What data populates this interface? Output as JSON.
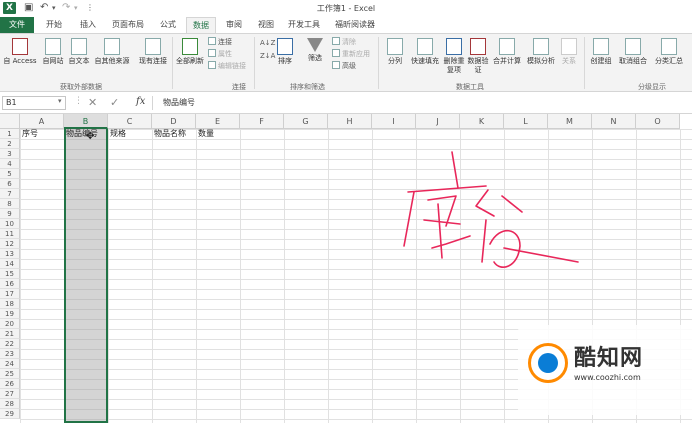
{
  "title_bar": {
    "app_logo": "X",
    "window_title": "工作簿1 - Excel",
    "qat": [
      "save-icon",
      "undo-icon",
      "redo-icon",
      "customize-icon"
    ]
  },
  "tabs": [
    {
      "label": "文件",
      "active": false
    },
    {
      "label": "开始",
      "active": false
    },
    {
      "label": "插入",
      "active": false
    },
    {
      "label": "页面布局",
      "active": false
    },
    {
      "label": "公式",
      "active": false
    },
    {
      "label": "数据",
      "active": true
    },
    {
      "label": "审阅",
      "active": false
    },
    {
      "label": "视图",
      "active": false
    },
    {
      "label": "开发工具",
      "active": false
    },
    {
      "label": "福昕阅读器",
      "active": false
    }
  ],
  "ribbon": {
    "get_external": {
      "buttons": [
        "自 Access",
        "自网站",
        "自文本",
        "自其他来源",
        "现有连接"
      ],
      "label": "获取外部数据"
    },
    "connections": {
      "refresh_all": "全部刷新",
      "small": [
        "连接",
        "属性",
        "编辑链接"
      ],
      "label": "连接"
    },
    "sort_filter": {
      "sort": "排序",
      "filter": "筛选",
      "small": [
        "清除",
        "重新应用",
        "高级"
      ],
      "sort_icons": [
        "A↓Z",
        "Z↓A"
      ],
      "label": "排序和筛选"
    },
    "data_tools": {
      "buttons": [
        "分列",
        "快速填充",
        "删除重复项",
        "数据验证",
        "合并计算",
        "模拟分析",
        "关系"
      ],
      "label": "数据工具"
    },
    "outline": {
      "buttons": [
        "创建组",
        "取消组合",
        "分类汇总"
      ],
      "label": "分级显示"
    }
  },
  "formula_bar": {
    "name_box": "B1",
    "fx": "fx",
    "content": "物品编号"
  },
  "grid": {
    "columns": [
      "A",
      "B",
      "C",
      "D",
      "E",
      "F",
      "G",
      "H",
      "I",
      "J",
      "K",
      "L",
      "M",
      "N",
      "O"
    ],
    "selected_column": "B",
    "rows": [
      "1",
      "2",
      "3",
      "4",
      "5",
      "6",
      "7",
      "8",
      "9",
      "10",
      "11",
      "12",
      "13",
      "14",
      "15",
      "16",
      "17",
      "18",
      "19",
      "20",
      "21",
      "22",
      "23",
      "24",
      "25",
      "26",
      "27",
      "28",
      "29"
    ],
    "row1": {
      "a": "序号",
      "b": "物品编号",
      "c": "规格",
      "d": "物品名称",
      "e": "数量"
    }
  },
  "handwriting_color": "#e8275a",
  "accent": "#217346",
  "watermark": {
    "name": "酷知网",
    "url": "www.coozhi.com"
  }
}
